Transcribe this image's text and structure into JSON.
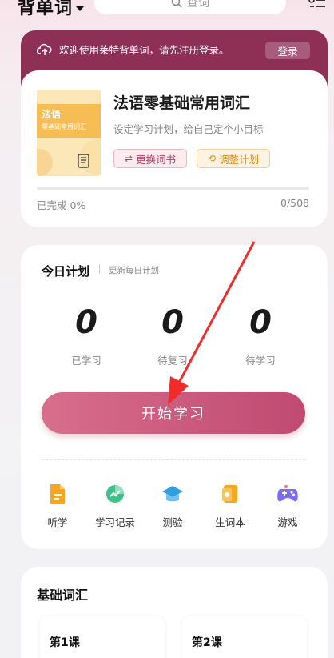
{
  "header": {
    "app_title": "背单词",
    "search_placeholder": "查词"
  },
  "banner": {
    "message": "欢迎使用莱特背单词，请先注册登录。",
    "login_label": "登录"
  },
  "book": {
    "cover_title": "法语",
    "cover_subtitle": "零基础常用词汇",
    "title": "法语零基础常用词汇",
    "description": "设定学习计划，给自己定个小目标",
    "change_book_label": "更换词书",
    "adjust_plan_label": "调整计划",
    "progress_fraction": 0.0,
    "progress_label": "已完成 0%",
    "progress_count": "0/508"
  },
  "plan": {
    "title": "今日计划",
    "subtitle": "更新每日计划",
    "stats": [
      {
        "value": "0",
        "label": "已学习"
      },
      {
        "value": "0",
        "label": "待复习"
      },
      {
        "value": "0",
        "label": "待学习"
      }
    ],
    "start_label": "开始学习",
    "tools": [
      {
        "label": "听学",
        "icon": "headphone-doc-icon"
      },
      {
        "label": "学习记录",
        "icon": "chart-record-icon"
      },
      {
        "label": "测验",
        "icon": "graduation-cap-icon"
      },
      {
        "label": "生词本",
        "icon": "notebook-icon"
      },
      {
        "label": "游戏",
        "icon": "gamepad-icon"
      }
    ]
  },
  "vocab": {
    "title": "基础词汇",
    "lessons": [
      "第1课",
      "第2课"
    ]
  },
  "colors": {
    "brand": "#8e2f55",
    "accent": "#c04a72",
    "orange": "#f6a623"
  }
}
